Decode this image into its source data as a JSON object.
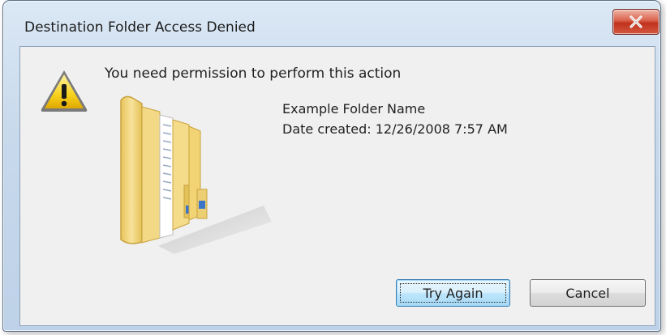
{
  "window": {
    "title": "Destination Folder Access Denied",
    "close_icon": "close-icon"
  },
  "dialog": {
    "message": "You need permission to perform this action",
    "warning_icon": "warning-icon",
    "folder_icon": "folder-icon",
    "item_name": "Example Folder Name",
    "date_created": "Date created: 12/26/2008 7:57 AM"
  },
  "buttons": {
    "try_again_label": "Try Again",
    "cancel_label": "Cancel"
  },
  "colors": {
    "close_button": "#c8412a",
    "client_background": "#f0f0f0",
    "default_button_border": "#3c7fb1",
    "folder_yellow": "#f2d77a"
  }
}
